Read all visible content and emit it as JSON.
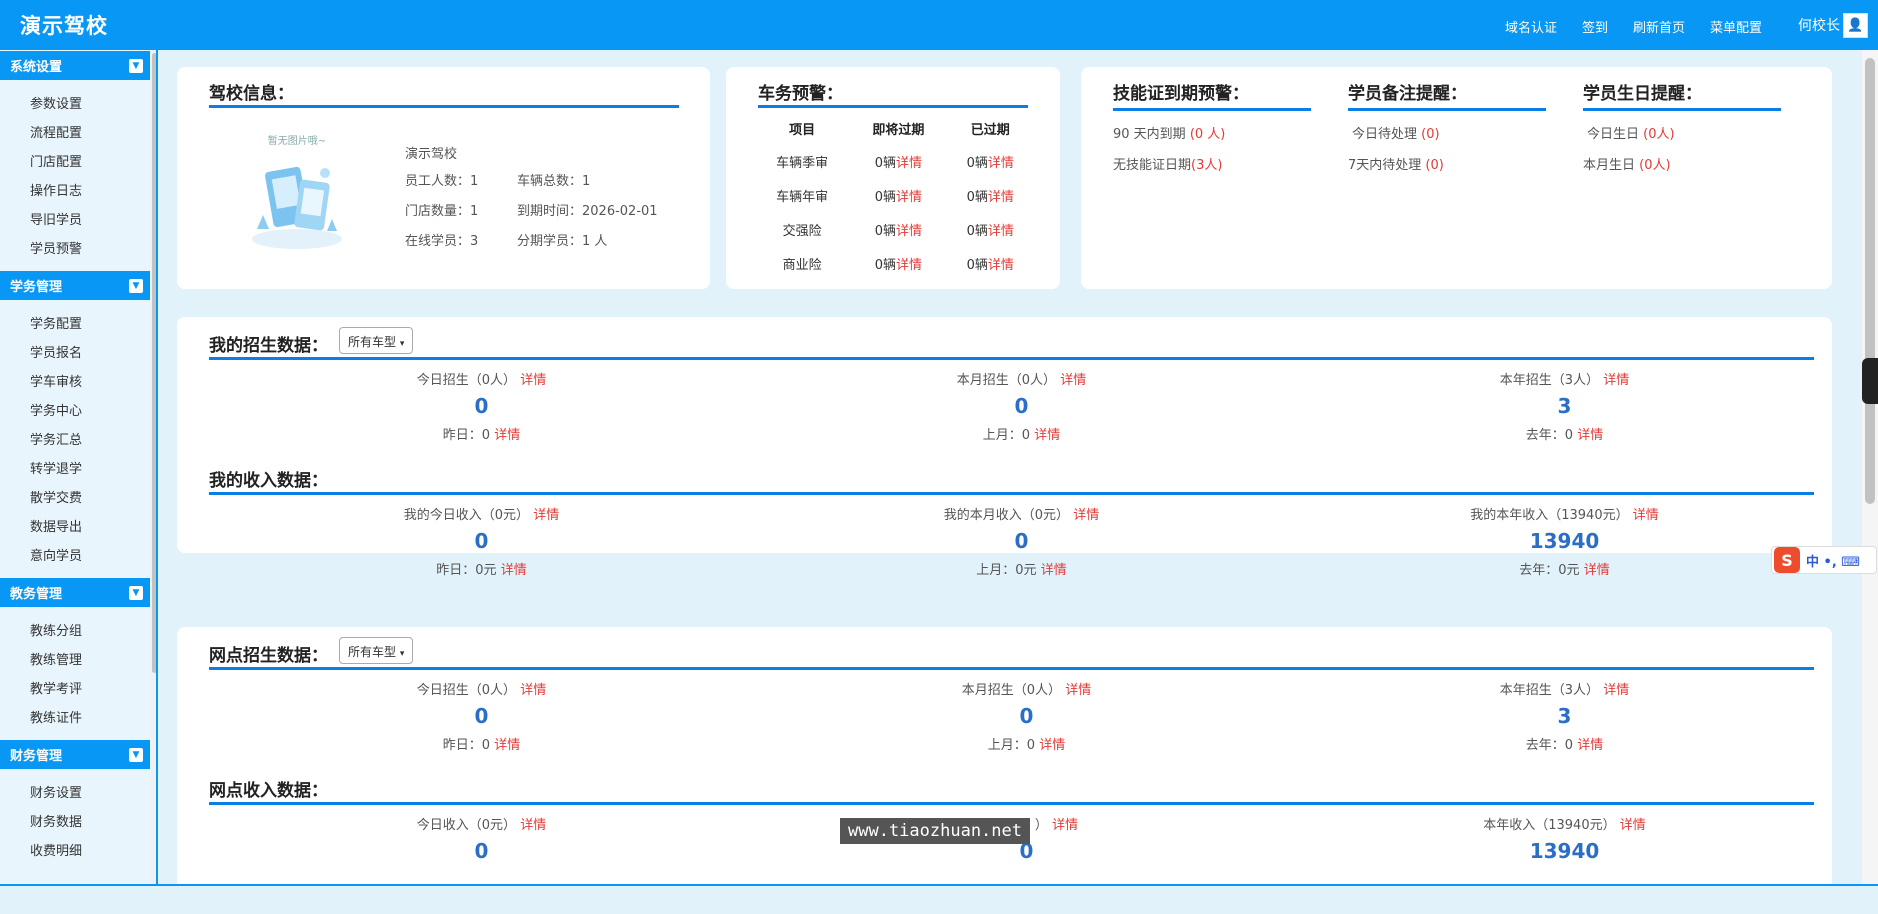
{
  "header": {
    "brand": "演示驾校",
    "nav": [
      "域名认证",
      "签到",
      "刷新首页",
      "菜单配置"
    ],
    "user": "何校长"
  },
  "sidebar": [
    {
      "title": "系统设置",
      "items": [
        "参数设置",
        "流程配置",
        "门店配置",
        "操作日志",
        "导旧学员",
        "学员预警"
      ]
    },
    {
      "title": "学务管理",
      "items": [
        "学务配置",
        "学员报名",
        "学车审核",
        "学务中心",
        "学务汇总",
        "转学退学",
        "散学交费",
        "数据导出",
        "意向学员"
      ]
    },
    {
      "title": "教务管理",
      "items": [
        "教练分组",
        "教练管理",
        "教学考评",
        "教练证件"
      ]
    },
    {
      "title": "财务管理",
      "items": [
        "财务设置",
        "财务数据",
        "收费明细"
      ]
    }
  ],
  "school_info": {
    "title": "驾校信息：",
    "placeholder_text": "暂无图片哦~",
    "name": "演示驾校",
    "rows": [
      [
        "员工人数：",
        "1",
        "车辆总数：",
        "1"
      ],
      [
        "门店数量：",
        "1",
        "到期时间：",
        "2026-02-01"
      ],
      [
        "在线学员：",
        "3",
        "分期学员：",
        "1 人"
      ]
    ]
  },
  "vehicle_alert": {
    "title": "车务预警：",
    "headers": [
      "项目",
      "即将过期",
      "已过期"
    ],
    "rows": [
      {
        "name": "车辆季审",
        "soon": "0辆",
        "expired": "0辆"
      },
      {
        "name": "车辆年审",
        "soon": "0辆",
        "expired": "0辆"
      },
      {
        "name": "交强险",
        "soon": "0辆",
        "expired": "0辆"
      },
      {
        "name": "商业险",
        "soon": "0辆",
        "expired": "0辆"
      }
    ],
    "detail": "详情"
  },
  "skill_alert": {
    "title": "技能证到期预警：",
    "line1_label": "90 天内到期 ",
    "line1_value": "(0 人)",
    "line2_label": "无技能证日期",
    "line2_value": "(3人)"
  },
  "note_alert": {
    "title": "学员备注提醒：",
    "line1_label": "今日待处理 ",
    "line1_value": "(0)",
    "line2_label": "7天内待处理 ",
    "line2_value": "(0)"
  },
  "birthday_alert": {
    "title": "学员生日提醒：",
    "line1_label": "今日生日 ",
    "line1_value": "(0人)",
    "line2_label": "本月生日 ",
    "line2_value": "(0人)"
  },
  "my_enroll": {
    "title": "我的招生数据：",
    "select": "所有车型",
    "cols": [
      {
        "label": "今日招生（0人）",
        "value": "0",
        "prev": "昨日：0"
      },
      {
        "label": "本月招生（0人）",
        "value": "0",
        "prev": "上月：0"
      },
      {
        "label": "本年招生（3人）",
        "value": "3",
        "prev": "去年：0"
      }
    ]
  },
  "my_income": {
    "title": "我的收入数据：",
    "cols": [
      {
        "label": "我的今日收入（0元）",
        "value": "0",
        "prev": "昨日：0元"
      },
      {
        "label": "我的本月收入（0元）",
        "value": "0",
        "prev": "上月：0元"
      },
      {
        "label": "我的本年收入（13940元）",
        "value": "13940",
        "prev": "去年：0元"
      }
    ]
  },
  "branch_enroll": {
    "title": "网点招生数据：",
    "select": "所有车型",
    "cols": [
      {
        "label": "今日招生（0人）",
        "value": "0",
        "prev": "昨日：0"
      },
      {
        "label": "本月招生（0人）",
        "value": "0",
        "prev": "上月：0"
      },
      {
        "label": "本年招生（3人）",
        "value": "3",
        "prev": "去年：0"
      }
    ]
  },
  "branch_income": {
    "title": "网点收入数据：",
    "cols": [
      {
        "label": "今日收入（0元）",
        "value": "0"
      },
      {
        "label": "）",
        "value": "0"
      },
      {
        "label": "本年收入（13940元）",
        "value": "13940"
      }
    ]
  },
  "detail": "详情",
  "watermark": "www.tiaozhuan.net",
  "ime": {
    "logo": "S",
    "text": "中 •, ⌨"
  }
}
